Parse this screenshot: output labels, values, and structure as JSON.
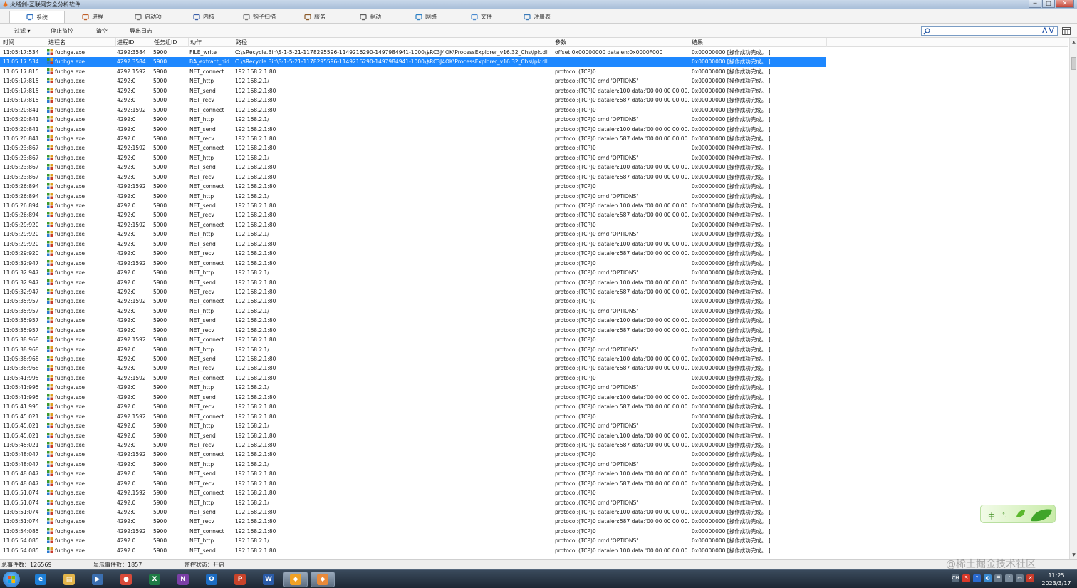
{
  "window": {
    "title": "火绒剑-互联网安全分析软件",
    "buttons": {
      "minimize": "─",
      "maximize": "□",
      "close": "✕"
    }
  },
  "tabs": [
    {
      "label": "系统",
      "icon": "monitor-icon",
      "active": true
    },
    {
      "label": "进程",
      "icon": "process-icon",
      "active": false
    },
    {
      "label": "启动项",
      "icon": "startup-icon",
      "active": false
    },
    {
      "label": "内核",
      "icon": "kernel-icon",
      "active": false
    },
    {
      "label": "钩子扫描",
      "icon": "hook-icon",
      "active": false
    },
    {
      "label": "服务",
      "icon": "service-icon",
      "active": false
    },
    {
      "label": "驱动",
      "icon": "driver-icon",
      "active": false
    },
    {
      "label": "网络",
      "icon": "network-icon",
      "active": false
    },
    {
      "label": "文件",
      "icon": "file-icon",
      "active": false
    },
    {
      "label": "注册表",
      "icon": "registry-icon",
      "active": false
    }
  ],
  "toolbar": {
    "filter": "过滤 ▾",
    "stop": "停止监控",
    "clear": "清空",
    "export": "导出日志",
    "search_placeholder": "",
    "search_arrows": "⋀⋁"
  },
  "columns": [
    "时间",
    "进程名",
    "进程ID",
    "任务组ID",
    "动作",
    "路径",
    "参数",
    "结果"
  ],
  "rows": [
    [
      "11:05:17:534",
      "fubhga.exe",
      "4292:3584",
      "5900",
      "FILE_write",
      "C:\\$Recycle.Bin\\S-1-5-21-1178295596-1149216290-1497984941-1000\\$RC3J4OK\\ProcessExplorer_v16.32_Chs\\lpk.dll",
      "offset:0x00000000 datalen:0x0000F000",
      "0x00000000 [操作成功完成。 ]"
    ],
    [
      "11:05:17:534",
      "fubhga.exe",
      "4292:3584",
      "5900",
      "BA_extract_hid...",
      "C:\\$Recycle.Bin\\S-1-5-21-1178295596-1149216290-1497984941-1000\\$RC3J4OK\\ProcessExplorer_v16.32_Chs\\lpk.dll",
      "",
      "0x00000000 [操作成功完成。 ]"
    ],
    [
      "11:05:17:815",
      "fubhga.exe",
      "4292:1592",
      "5900",
      "NET_connect",
      "192.168.2.1:80",
      "protocol:(TCP)0",
      "0x00000000 [操作成功完成。 ]"
    ],
    [
      "11:05:17:815",
      "fubhga.exe",
      "4292:0",
      "5900",
      "NET_http",
      "192.168.2.1/",
      "protocol:(TCP)0 cmd:'OPTIONS'",
      "0x00000000 [操作成功完成。 ]"
    ],
    [
      "11:05:17:815",
      "fubhga.exe",
      "4292:0",
      "5900",
      "NET_send",
      "192.168.2.1:80",
      "protocol:(TCP)0 datalen:100 data:'00 00 00 00 00...",
      "0x00000000 [操作成功完成。 ]"
    ],
    [
      "11:05:17:815",
      "fubhga.exe",
      "4292:0",
      "5900",
      "NET_recv",
      "192.168.2.1:80",
      "protocol:(TCP)0 datalen:587 data:'00 00 00 00 00...",
      "0x00000000 [操作成功完成。 ]"
    ],
    [
      "11:05:20:841",
      "fubhga.exe",
      "4292:1592",
      "5900",
      "NET_connect",
      "192.168.2.1:80",
      "protocol:(TCP)0",
      "0x00000000 [操作成功完成。 ]"
    ],
    [
      "11:05:20:841",
      "fubhga.exe",
      "4292:0",
      "5900",
      "NET_http",
      "192.168.2.1/",
      "protocol:(TCP)0 cmd:'OPTIONS'",
      "0x00000000 [操作成功完成。 ]"
    ],
    [
      "11:05:20:841",
      "fubhga.exe",
      "4292:0",
      "5900",
      "NET_send",
      "192.168.2.1:80",
      "protocol:(TCP)0 datalen:100 data:'00 00 00 00 00...",
      "0x00000000 [操作成功完成。 ]"
    ],
    [
      "11:05:20:841",
      "fubhga.exe",
      "4292:0",
      "5900",
      "NET_recv",
      "192.168.2.1:80",
      "protocol:(TCP)0 datalen:587 data:'00 00 00 00 00...",
      "0x00000000 [操作成功完成。 ]"
    ],
    [
      "11:05:23:867",
      "fubhga.exe",
      "4292:1592",
      "5900",
      "NET_connect",
      "192.168.2.1:80",
      "protocol:(TCP)0",
      "0x00000000 [操作成功完成。 ]"
    ],
    [
      "11:05:23:867",
      "fubhga.exe",
      "4292:0",
      "5900",
      "NET_http",
      "192.168.2.1/",
      "protocol:(TCP)0 cmd:'OPTIONS'",
      "0x00000000 [操作成功完成。 ]"
    ],
    [
      "11:05:23:867",
      "fubhga.exe",
      "4292:0",
      "5900",
      "NET_send",
      "192.168.2.1:80",
      "protocol:(TCP)0 datalen:100 data:'00 00 00 00 00...",
      "0x00000000 [操作成功完成。 ]"
    ],
    [
      "11:05:23:867",
      "fubhga.exe",
      "4292:0",
      "5900",
      "NET_recv",
      "192.168.2.1:80",
      "protocol:(TCP)0 datalen:587 data:'00 00 00 00 00...",
      "0x00000000 [操作成功完成。 ]"
    ],
    [
      "11:05:26:894",
      "fubhga.exe",
      "4292:1592",
      "5900",
      "NET_connect",
      "192.168.2.1:80",
      "protocol:(TCP)0",
      "0x00000000 [操作成功完成。 ]"
    ],
    [
      "11:05:26:894",
      "fubhga.exe",
      "4292:0",
      "5900",
      "NET_http",
      "192.168.2.1/",
      "protocol:(TCP)0 cmd:'OPTIONS'",
      "0x00000000 [操作成功完成。 ]"
    ],
    [
      "11:05:26:894",
      "fubhga.exe",
      "4292:0",
      "5900",
      "NET_send",
      "192.168.2.1:80",
      "protocol:(TCP)0 datalen:100 data:'00 00 00 00 00...",
      "0x00000000 [操作成功完成。 ]"
    ],
    [
      "11:05:26:894",
      "fubhga.exe",
      "4292:0",
      "5900",
      "NET_recv",
      "192.168.2.1:80",
      "protocol:(TCP)0 datalen:587 data:'00 00 00 00 00...",
      "0x00000000 [操作成功完成。 ]"
    ],
    [
      "11:05:29:920",
      "fubhga.exe",
      "4292:1592",
      "5900",
      "NET_connect",
      "192.168.2.1:80",
      "protocol:(TCP)0",
      "0x00000000 [操作成功完成。 ]"
    ],
    [
      "11:05:29:920",
      "fubhga.exe",
      "4292:0",
      "5900",
      "NET_http",
      "192.168.2.1/",
      "protocol:(TCP)0 cmd:'OPTIONS'",
      "0x00000000 [操作成功完成。 ]"
    ],
    [
      "11:05:29:920",
      "fubhga.exe",
      "4292:0",
      "5900",
      "NET_send",
      "192.168.2.1:80",
      "protocol:(TCP)0 datalen:100 data:'00 00 00 00 00...",
      "0x00000000 [操作成功完成。 ]"
    ],
    [
      "11:05:29:920",
      "fubhga.exe",
      "4292:0",
      "5900",
      "NET_recv",
      "192.168.2.1:80",
      "protocol:(TCP)0 datalen:587 data:'00 00 00 00 00...",
      "0x00000000 [操作成功完成。 ]"
    ],
    [
      "11:05:32:947",
      "fubhga.exe",
      "4292:1592",
      "5900",
      "NET_connect",
      "192.168.2.1:80",
      "protocol:(TCP)0",
      "0x00000000 [操作成功完成。 ]"
    ],
    [
      "11:05:32:947",
      "fubhga.exe",
      "4292:0",
      "5900",
      "NET_http",
      "192.168.2.1/",
      "protocol:(TCP)0 cmd:'OPTIONS'",
      "0x00000000 [操作成功完成。 ]"
    ],
    [
      "11:05:32:947",
      "fubhga.exe",
      "4292:0",
      "5900",
      "NET_send",
      "192.168.2.1:80",
      "protocol:(TCP)0 datalen:100 data:'00 00 00 00 00...",
      "0x00000000 [操作成功完成。 ]"
    ],
    [
      "11:05:32:947",
      "fubhga.exe",
      "4292:0",
      "5900",
      "NET_recv",
      "192.168.2.1:80",
      "protocol:(TCP)0 datalen:587 data:'00 00 00 00 00...",
      "0x00000000 [操作成功完成。 ]"
    ],
    [
      "11:05:35:957",
      "fubhga.exe",
      "4292:1592",
      "5900",
      "NET_connect",
      "192.168.2.1:80",
      "protocol:(TCP)0",
      "0x00000000 [操作成功完成。 ]"
    ],
    [
      "11:05:35:957",
      "fubhga.exe",
      "4292:0",
      "5900",
      "NET_http",
      "192.168.2.1/",
      "protocol:(TCP)0 cmd:'OPTIONS'",
      "0x00000000 [操作成功完成。 ]"
    ],
    [
      "11:05:35:957",
      "fubhga.exe",
      "4292:0",
      "5900",
      "NET_send",
      "192.168.2.1:80",
      "protocol:(TCP)0 datalen:100 data:'00 00 00 00 00...",
      "0x00000000 [操作成功完成。 ]"
    ],
    [
      "11:05:35:957",
      "fubhga.exe",
      "4292:0",
      "5900",
      "NET_recv",
      "192.168.2.1:80",
      "protocol:(TCP)0 datalen:587 data:'00 00 00 00 00...",
      "0x00000000 [操作成功完成。 ]"
    ],
    [
      "11:05:38:968",
      "fubhga.exe",
      "4292:1592",
      "5900",
      "NET_connect",
      "192.168.2.1:80",
      "protocol:(TCP)0",
      "0x00000000 [操作成功完成。 ]"
    ],
    [
      "11:05:38:968",
      "fubhga.exe",
      "4292:0",
      "5900",
      "NET_http",
      "192.168.2.1/",
      "protocol:(TCP)0 cmd:'OPTIONS'",
      "0x00000000 [操作成功完成。 ]"
    ],
    [
      "11:05:38:968",
      "fubhga.exe",
      "4292:0",
      "5900",
      "NET_send",
      "192.168.2.1:80",
      "protocol:(TCP)0 datalen:100 data:'00 00 00 00 00...",
      "0x00000000 [操作成功完成。 ]"
    ],
    [
      "11:05:38:968",
      "fubhga.exe",
      "4292:0",
      "5900",
      "NET_recv",
      "192.168.2.1:80",
      "protocol:(TCP)0 datalen:587 data:'00 00 00 00 00...",
      "0x00000000 [操作成功完成。 ]"
    ],
    [
      "11:05:41:995",
      "fubhga.exe",
      "4292:1592",
      "5900",
      "NET_connect",
      "192.168.2.1:80",
      "protocol:(TCP)0",
      "0x00000000 [操作成功完成。 ]"
    ],
    [
      "11:05:41:995",
      "fubhga.exe",
      "4292:0",
      "5900",
      "NET_http",
      "192.168.2.1/",
      "protocol:(TCP)0 cmd:'OPTIONS'",
      "0x00000000 [操作成功完成。 ]"
    ],
    [
      "11:05:41:995",
      "fubhga.exe",
      "4292:0",
      "5900",
      "NET_send",
      "192.168.2.1:80",
      "protocol:(TCP)0 datalen:100 data:'00 00 00 00 00...",
      "0x00000000 [操作成功完成。 ]"
    ],
    [
      "11:05:41:995",
      "fubhga.exe",
      "4292:0",
      "5900",
      "NET_recv",
      "192.168.2.1:80",
      "protocol:(TCP)0 datalen:587 data:'00 00 00 00 00...",
      "0x00000000 [操作成功完成。 ]"
    ],
    [
      "11:05:45:021",
      "fubhga.exe",
      "4292:1592",
      "5900",
      "NET_connect",
      "192.168.2.1:80",
      "protocol:(TCP)0",
      "0x00000000 [操作成功完成。 ]"
    ],
    [
      "11:05:45:021",
      "fubhga.exe",
      "4292:0",
      "5900",
      "NET_http",
      "192.168.2.1/",
      "protocol:(TCP)0 cmd:'OPTIONS'",
      "0x00000000 [操作成功完成。 ]"
    ],
    [
      "11:05:45:021",
      "fubhga.exe",
      "4292:0",
      "5900",
      "NET_send",
      "192.168.2.1:80",
      "protocol:(TCP)0 datalen:100 data:'00 00 00 00 00...",
      "0x00000000 [操作成功完成。 ]"
    ],
    [
      "11:05:45:021",
      "fubhga.exe",
      "4292:0",
      "5900",
      "NET_recv",
      "192.168.2.1:80",
      "protocol:(TCP)0 datalen:587 data:'00 00 00 00 00...",
      "0x00000000 [操作成功完成。 ]"
    ],
    [
      "11:05:48:047",
      "fubhga.exe",
      "4292:1592",
      "5900",
      "NET_connect",
      "192.168.2.1:80",
      "protocol:(TCP)0",
      "0x00000000 [操作成功完成。 ]"
    ],
    [
      "11:05:48:047",
      "fubhga.exe",
      "4292:0",
      "5900",
      "NET_http",
      "192.168.2.1/",
      "protocol:(TCP)0 cmd:'OPTIONS'",
      "0x00000000 [操作成功完成。 ]"
    ],
    [
      "11:05:48:047",
      "fubhga.exe",
      "4292:0",
      "5900",
      "NET_send",
      "192.168.2.1:80",
      "protocol:(TCP)0 datalen:100 data:'00 00 00 00 00...",
      "0x00000000 [操作成功完成。 ]"
    ],
    [
      "11:05:48:047",
      "fubhga.exe",
      "4292:0",
      "5900",
      "NET_recv",
      "192.168.2.1:80",
      "protocol:(TCP)0 datalen:587 data:'00 00 00 00 00...",
      "0x00000000 [操作成功完成。 ]"
    ],
    [
      "11:05:51:074",
      "fubhga.exe",
      "4292:1592",
      "5900",
      "NET_connect",
      "192.168.2.1:80",
      "protocol:(TCP)0",
      "0x00000000 [操作成功完成。 ]"
    ],
    [
      "11:05:51:074",
      "fubhga.exe",
      "4292:0",
      "5900",
      "NET_http",
      "192.168.2.1/",
      "protocol:(TCP)0 cmd:'OPTIONS'",
      "0x00000000 [操作成功完成。 ]"
    ],
    [
      "11:05:51:074",
      "fubhga.exe",
      "4292:0",
      "5900",
      "NET_send",
      "192.168.2.1:80",
      "protocol:(TCP)0 datalen:100 data:'00 00 00 00 00...",
      "0x00000000 [操作成功完成。 ]"
    ],
    [
      "11:05:51:074",
      "fubhga.exe",
      "4292:0",
      "5900",
      "NET_recv",
      "192.168.2.1:80",
      "protocol:(TCP)0 datalen:587 data:'00 00 00 00 00...",
      "0x00000000 [操作成功完成。 ]"
    ],
    [
      "11:05:54:085",
      "fubhga.exe",
      "4292:1592",
      "5900",
      "NET_connect",
      "192.168.2.1:80",
      "protocol:(TCP)0",
      "0x00000000 [操作成功完成。 ]"
    ],
    [
      "11:05:54:085",
      "fubhga.exe",
      "4292:0",
      "5900",
      "NET_http",
      "192.168.2.1/",
      "protocol:(TCP)0 cmd:'OPTIONS'",
      "0x00000000 [操作成功完成。 ]"
    ],
    [
      "11:05:54:085",
      "fubhga.exe",
      "4292:0",
      "5900",
      "NET_send",
      "192.168.2.1:80",
      "protocol:(TCP)0 datalen:100 data:'00 00 00 00 00...",
      "0x00000000 [操作成功完成。 ]"
    ]
  ],
  "selected_row": 1,
  "statusbar": {
    "total": "总事件数：126569",
    "shown": "显示事件数：1857",
    "monitor": "监控状态：开启"
  },
  "ime": {
    "label": "中",
    "dot": "°,"
  },
  "watermark": "@稀土掘金技术社区",
  "taskbar": {
    "apps": [
      {
        "name": "ie",
        "glyph": "e",
        "color": "#1e7fd6"
      },
      {
        "name": "explorer",
        "glyph": "▤",
        "color": "#e3b54a"
      },
      {
        "name": "media",
        "glyph": "▶",
        "color": "#3b6fb0"
      },
      {
        "name": "chrome",
        "glyph": "●",
        "color": "#d84a3a"
      },
      {
        "name": "excel",
        "glyph": "X",
        "color": "#1e7b45"
      },
      {
        "name": "onenote",
        "glyph": "N",
        "color": "#7b3fa6"
      },
      {
        "name": "outlook",
        "glyph": "O",
        "color": "#1c6cc2"
      },
      {
        "name": "powerpoint",
        "glyph": "P",
        "color": "#c8432a"
      },
      {
        "name": "word",
        "glyph": "W",
        "color": "#2a5ba8"
      },
      {
        "name": "huorong-1",
        "glyph": "◆",
        "color": "#f0a125"
      },
      {
        "name": "huorong-2",
        "glyph": "◆",
        "color": "#e8893a"
      }
    ],
    "tray": [
      "CH",
      "S",
      "?",
      "◐",
      "☰",
      "♪",
      "▭",
      "✕"
    ],
    "time": "11:25",
    "date": "2023/3/17"
  },
  "colors": {
    "selection": "#1e88ff",
    "process_icon": "#3a9a2b"
  }
}
